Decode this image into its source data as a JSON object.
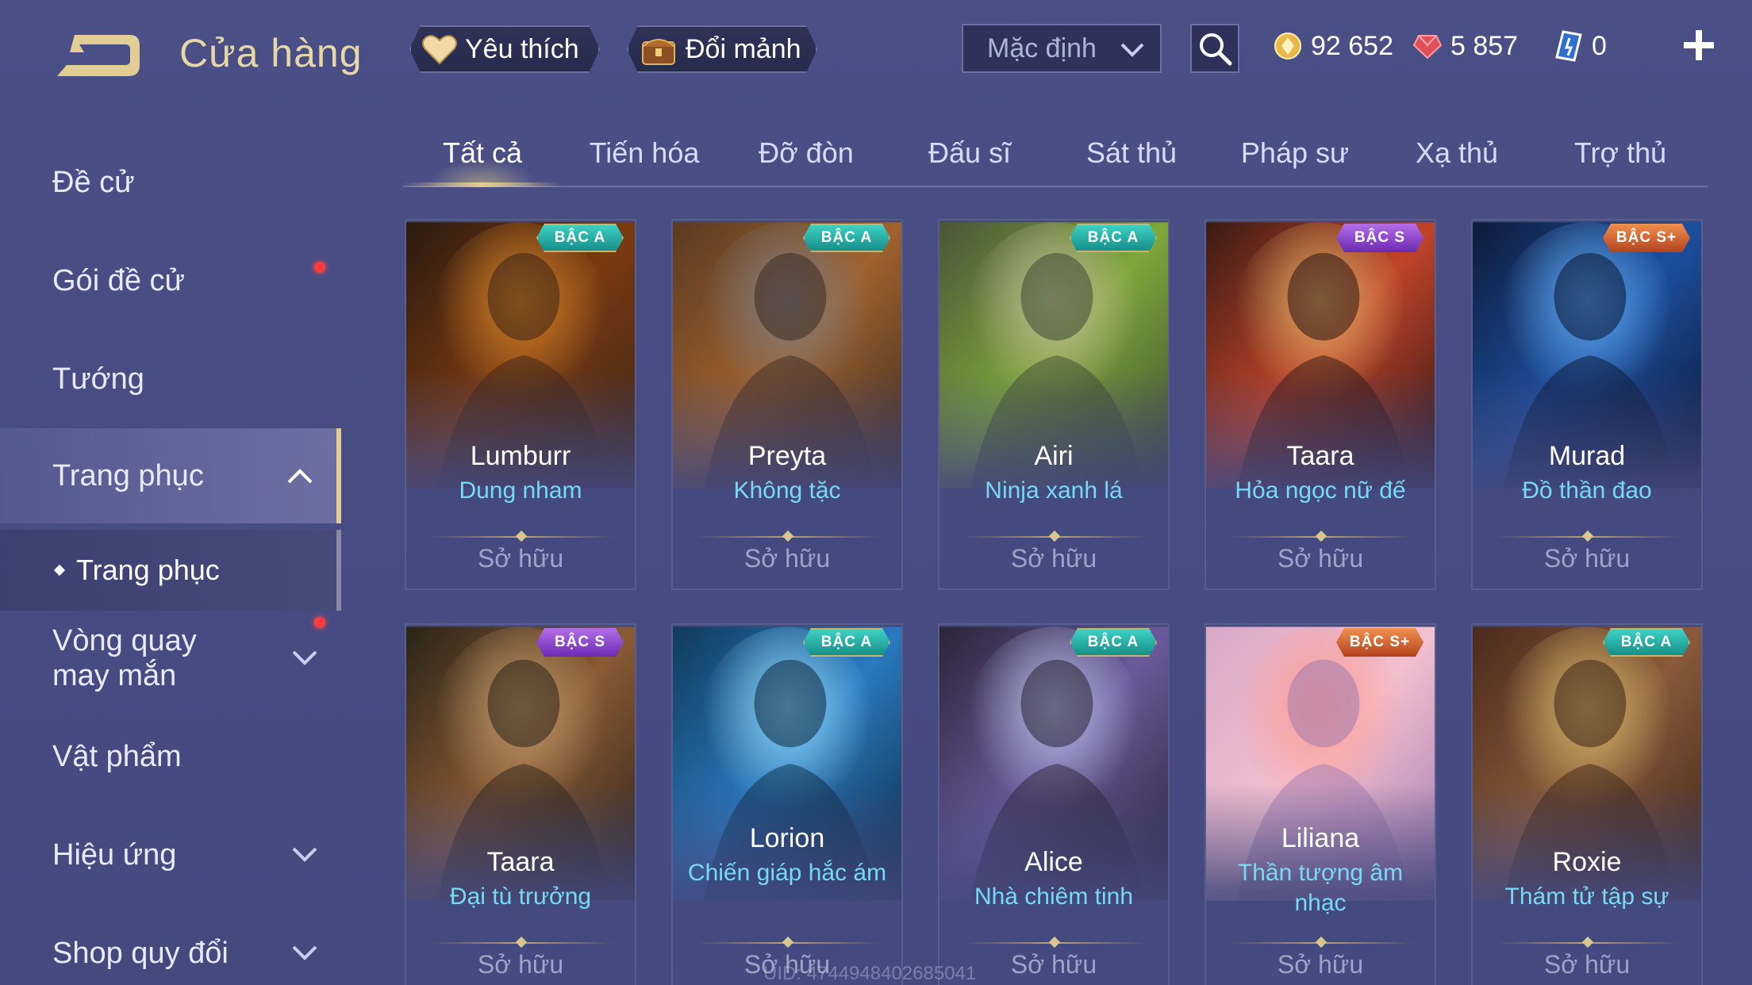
{
  "header": {
    "title": "Cửa hàng",
    "favorite_label": "Yêu thích",
    "exchange_label": "Đổi mảnh",
    "sort_value": "Mặc định",
    "currencies": {
      "gold": "92 652",
      "ruby": "5 857",
      "voucher": "0"
    }
  },
  "sidebar": {
    "items": [
      {
        "label": "Đề cử"
      },
      {
        "label": "Gói đề cử"
      },
      {
        "label": "Tướng"
      },
      {
        "label": "Trang phục"
      },
      {
        "label": "Trang phục"
      },
      {
        "label": "Vòng quay may mắn"
      },
      {
        "label": "Vật phẩm"
      },
      {
        "label": "Hiệu ứng"
      },
      {
        "label": "Shop quy đổi"
      }
    ]
  },
  "tabs": [
    "Tất cả",
    "Tiến hóa",
    "Đỡ đòn",
    "Đấu sĩ",
    "Sát thủ",
    "Pháp sư",
    "Xạ thủ",
    "Trợ thủ"
  ],
  "cards": [
    {
      "hero": "Lumburr",
      "skin": "Dung nham",
      "tier": "BẬC A",
      "status": "Sở hữu",
      "palette": [
        "#2a1a10",
        "#7a3a12",
        "#e08a2a",
        "#3a2418"
      ]
    },
    {
      "hero": "Preyta",
      "skin": "Không tặc",
      "tier": "BẬC A",
      "status": "Sở hữu",
      "palette": [
        "#5a3a22",
        "#a0622e",
        "#7d8088",
        "#3a2a22"
      ]
    },
    {
      "hero": "Airi",
      "skin": "Ninja xanh lá",
      "tier": "BẬC A",
      "status": "Sở hữu",
      "palette": [
        "#49553a",
        "#7fa63a",
        "#c9c0a0",
        "#3b4a32"
      ]
    },
    {
      "hero": "Taara",
      "skin": "Hỏa ngọc nữ đế",
      "tier": "BẬC S",
      "status": "Sở hữu",
      "palette": [
        "#3a1a14",
        "#c0442a",
        "#e6b86a",
        "#2a1414"
      ]
    },
    {
      "hero": "Murad",
      "skin": "Đồ thần đao",
      "tier": "BẬC S+",
      "status": "Sở hữu",
      "palette": [
        "#0e1a3a",
        "#1d4f9e",
        "#66b4ff",
        "#0a1430"
      ]
    },
    {
      "hero": "Taara",
      "skin": "Đại tù trưởng",
      "tier": "BẬC S",
      "status": "Sở hữu",
      "palette": [
        "#2a2418",
        "#8a5a34",
        "#c8a070",
        "#2a221a"
      ]
    },
    {
      "hero": "Lorion",
      "skin": "Chiến giáp hắc ám",
      "tier": "BẬC A",
      "status": "Sở hữu",
      "palette": [
        "#103a5a",
        "#2a7ac0",
        "#9ae0ff",
        "#0c2840"
      ]
    },
    {
      "hero": "Alice",
      "skin": "Nhà chiêm tinh",
      "tier": "BẬC A",
      "status": "Sở hữu",
      "palette": [
        "#2a2438",
        "#6a5a9a",
        "#c0c8f0",
        "#2a2234"
      ]
    },
    {
      "hero": "Liliana",
      "skin": "Thần tượng âm nhạc",
      "tier": "BẬC S+",
      "status": "Sở hữu",
      "palette": [
        "#d8a8c8",
        "#f4c0d0",
        "#ff9a8a",
        "#a07ab0"
      ]
    },
    {
      "hero": "Roxie",
      "skin": "Thám tử tập sự",
      "tier": "BẬC A",
      "status": "Sở hữu",
      "palette": [
        "#4a2a1c",
        "#8a5a3a",
        "#e0c070",
        "#3a2418"
      ]
    }
  ],
  "uid_text": "UID: 4744948402685041",
  "colors": {
    "accent_gold": "#e2cd95",
    "skin_name": "#77d9f5",
    "notification": "#ff3b3b"
  }
}
